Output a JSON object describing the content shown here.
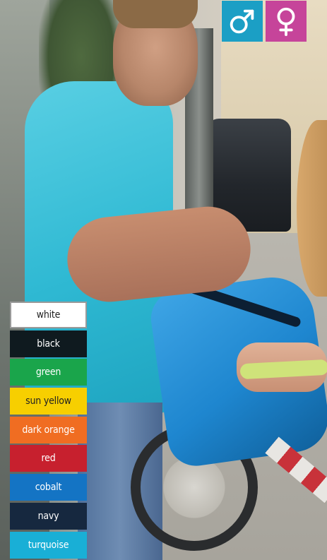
{
  "gender_icons": [
    {
      "icon": "male-symbol-icon",
      "color": "#1b9fc5"
    },
    {
      "icon": "female-symbol-icon",
      "color": "#c6449a"
    }
  ],
  "colors": [
    {
      "label": "white",
      "bg": "#ffffff",
      "fg": "#222222",
      "border": "#9a9a9a"
    },
    {
      "label": "black",
      "bg": "#0f1a1f",
      "fg": "#ffffff"
    },
    {
      "label": "green",
      "bg": "#1aa54b",
      "fg": "#ffffff"
    },
    {
      "label": "sun yellow",
      "bg": "#f7cf00",
      "fg": "#222222"
    },
    {
      "label": "dark orange",
      "bg": "#f06d22",
      "fg": "#ffffff"
    },
    {
      "label": "red",
      "bg": "#c7202e",
      "fg": "#ffffff"
    },
    {
      "label": "cobalt",
      "bg": "#1474c4",
      "fg": "#ffffff"
    },
    {
      "label": "navy",
      "bg": "#16283f",
      "fg": "#ffffff"
    },
    {
      "label": "turquoise",
      "bg": "#19afd6",
      "fg": "#ffffff"
    }
  ]
}
